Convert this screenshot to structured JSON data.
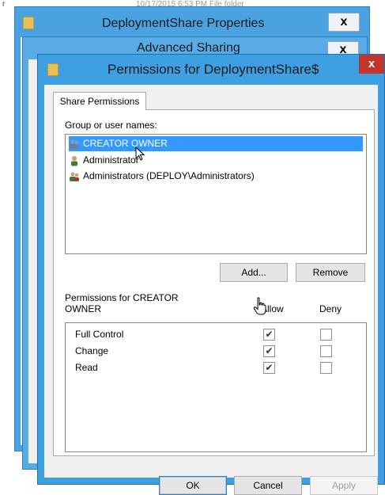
{
  "background_strip": {
    "text": "10/17/2015 6:53 PM     File folder",
    "left_mark": "r"
  },
  "properties_window": {
    "title": "DeploymentShare Properties",
    "close": "x"
  },
  "advanced_window": {
    "title": "Advanced Sharing",
    "close": "x"
  },
  "permissions_window": {
    "title": "Permissions for DeploymentShare$",
    "close": "x",
    "tab": "Share Permissions",
    "group_label": "Group or user names:",
    "users": [
      {
        "name": "CREATOR OWNER",
        "selected": true
      },
      {
        "name": "Administrator",
        "selected": false
      },
      {
        "name": "Administrators (DEPLOY\\Administrators)",
        "selected": false
      }
    ],
    "add_button": "Add...",
    "remove_button": "Remove",
    "perm_label_line1": "Permissions for CREATOR",
    "perm_label_line2": "OWNER",
    "allow_header": "Allow",
    "deny_header": "Deny",
    "permissions": [
      {
        "name": "Full Control",
        "allow": true,
        "deny": false
      },
      {
        "name": "Change",
        "allow": true,
        "deny": false
      },
      {
        "name": "Read",
        "allow": true,
        "deny": false
      }
    ],
    "ok_button": "OK",
    "cancel_button": "Cancel",
    "apply_button": "Apply"
  },
  "icons": {
    "folder": "folder-icon",
    "user_group": "user-group-icon",
    "user": "user-icon",
    "cursor": "hand-cursor-icon",
    "checkmark": "✔"
  },
  "colors": {
    "title_bar": "#3ea0e3",
    "close_red": "#c2352b",
    "selection": "#3399ff"
  }
}
